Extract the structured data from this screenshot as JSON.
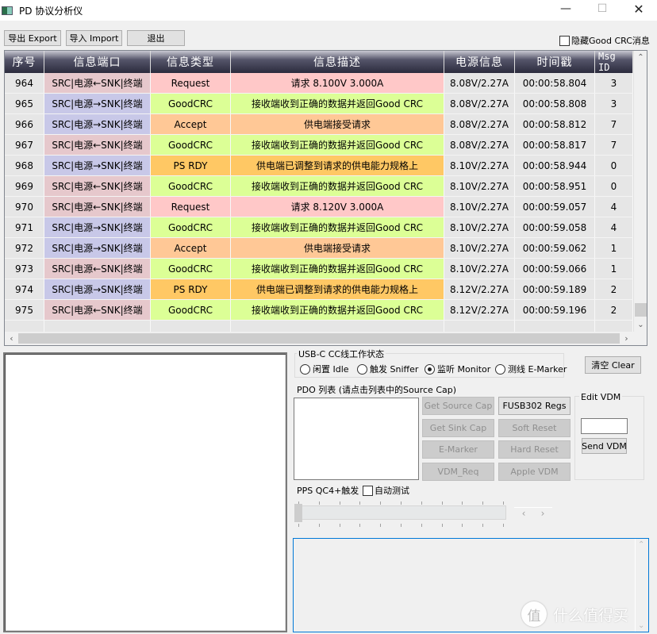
{
  "window": {
    "title": "PD 协议分析仪",
    "min_icon": "minimize-icon",
    "max_icon": "maximize-icon",
    "close_icon": "close-icon",
    "min_glyph": "—",
    "max_glyph": "☐",
    "close_glyph": "✕"
  },
  "toolbar": {
    "export_label": "导出 Export",
    "import_label": "导入 Import",
    "exit_label": "退出",
    "hide_goodcrc_label": "隐藏Good CRC消息",
    "hide_goodcrc_checked": false
  },
  "table": {
    "columns": [
      "序号",
      "信息端口",
      "信息类型",
      "信息描述",
      "电源信息",
      "时间戳",
      "Msg ID"
    ],
    "colors": {
      "port_sink_to_src": "#e6c8cc",
      "port_src_to_sink": "#c8c8e8",
      "Request": "#ffc8c8",
      "GoodCRC": "#dcff96",
      "Accept": "#ffc896",
      "PS RDY": "#ffc864",
      "neutral": "#e6e6e6"
    },
    "rows": [
      {
        "seq": "964",
        "port": "SRC|电源←SNK|终端",
        "dir": "in",
        "type": "Request",
        "desc": "请求 8.100V 3.000A",
        "power": "8.08V/2.27A",
        "time": "00:00:58.804",
        "msg_id": "3"
      },
      {
        "seq": "965",
        "port": "SRC|电源→SNK|终端",
        "dir": "out",
        "type": "GoodCRC",
        "desc": "接收端收到正确的数据并返回Good CRC",
        "power": "8.08V/2.27A",
        "time": "00:00:58.808",
        "msg_id": "3"
      },
      {
        "seq": "966",
        "port": "SRC|电源→SNK|终端",
        "dir": "out",
        "type": "Accept",
        "desc": "供电端接受请求",
        "power": "8.08V/2.27A",
        "time": "00:00:58.812",
        "msg_id": "7"
      },
      {
        "seq": "967",
        "port": "SRC|电源←SNK|终端",
        "dir": "in",
        "type": "GoodCRC",
        "desc": "接收端收到正确的数据并返回Good CRC",
        "power": "8.08V/2.27A",
        "time": "00:00:58.817",
        "msg_id": "7"
      },
      {
        "seq": "968",
        "port": "SRC|电源→SNK|终端",
        "dir": "out",
        "type": "PS RDY",
        "desc": "供电端已调整到请求的供电能力规格上",
        "power": "8.10V/2.27A",
        "time": "00:00:58.944",
        "msg_id": "0"
      },
      {
        "seq": "969",
        "port": "SRC|电源←SNK|终端",
        "dir": "in",
        "type": "GoodCRC",
        "desc": "接收端收到正确的数据并返回Good CRC",
        "power": "8.10V/2.27A",
        "time": "00:00:58.951",
        "msg_id": "0"
      },
      {
        "seq": "970",
        "port": "SRC|电源←SNK|终端",
        "dir": "in",
        "type": "Request",
        "desc": "请求 8.120V 3.000A",
        "power": "8.10V/2.27A",
        "time": "00:00:59.057",
        "msg_id": "4"
      },
      {
        "seq": "971",
        "port": "SRC|电源→SNK|终端",
        "dir": "out",
        "type": "GoodCRC",
        "desc": "接收端收到正确的数据并返回Good CRC",
        "power": "8.10V/2.27A",
        "time": "00:00:59.058",
        "msg_id": "4"
      },
      {
        "seq": "972",
        "port": "SRC|电源→SNK|终端",
        "dir": "out",
        "type": "Accept",
        "desc": "供电端接受请求",
        "power": "8.10V/2.27A",
        "time": "00:00:59.062",
        "msg_id": "1"
      },
      {
        "seq": "973",
        "port": "SRC|电源←SNK|终端",
        "dir": "in",
        "type": "GoodCRC",
        "desc": "接收端收到正确的数据并返回Good CRC",
        "power": "8.10V/2.27A",
        "time": "00:00:59.066",
        "msg_id": "1"
      },
      {
        "seq": "974",
        "port": "SRC|电源→SNK|终端",
        "dir": "out",
        "type": "PS RDY",
        "desc": "供电端已调整到请求的供电能力规格上",
        "power": "8.12V/2.27A",
        "time": "00:00:59.189",
        "msg_id": "2"
      },
      {
        "seq": "975",
        "port": "SRC|电源←SNK|终端",
        "dir": "in",
        "type": "GoodCRC",
        "desc": "接收端收到正确的数据并返回Good CRC",
        "power": "8.12V/2.27A",
        "time": "00:00:59.196",
        "msg_id": "2"
      }
    ],
    "scroll": {
      "up": "⌃",
      "down": "⌄",
      "left": "‹",
      "right": "›"
    }
  },
  "cc_status": {
    "title": "USB-C CC线工作状态",
    "options": [
      {
        "label": "闲置 Idle",
        "selected": false
      },
      {
        "label": "触发 Sniffer",
        "selected": false
      },
      {
        "label": "监听 Monitor",
        "selected": true
      },
      {
        "label": "测线 E-Marker",
        "selected": false
      }
    ]
  },
  "clear_label": "清空 Clear",
  "pdo": {
    "title": "PDO 列表 (请点击列表中的Source Cap)",
    "buttons": [
      {
        "label": "Get Source Cap",
        "enabled": false
      },
      {
        "label": "FUSB302 Regs",
        "enabled": true
      },
      {
        "label": "Get Sink Cap",
        "enabled": false
      },
      {
        "label": "Soft Reset",
        "enabled": false
      },
      {
        "label": "E-Marker",
        "enabled": false
      },
      {
        "label": "Hard Reset",
        "enabled": false
      },
      {
        "label": "VDM_Req",
        "enabled": false
      },
      {
        "label": "Apple VDM",
        "enabled": false
      }
    ]
  },
  "vdm": {
    "title": "Edit VDM",
    "input_value": "",
    "send_label": "Send VDM"
  },
  "pps": {
    "label": "PPS QC4+触发",
    "auto_test_label": "自动测试",
    "auto_test_checked": false,
    "slider_value_fraction": 0.0,
    "spin_left": "‹",
    "spin_right": "›"
  },
  "watermark": {
    "badge": "值",
    "text": "什么值得买"
  }
}
